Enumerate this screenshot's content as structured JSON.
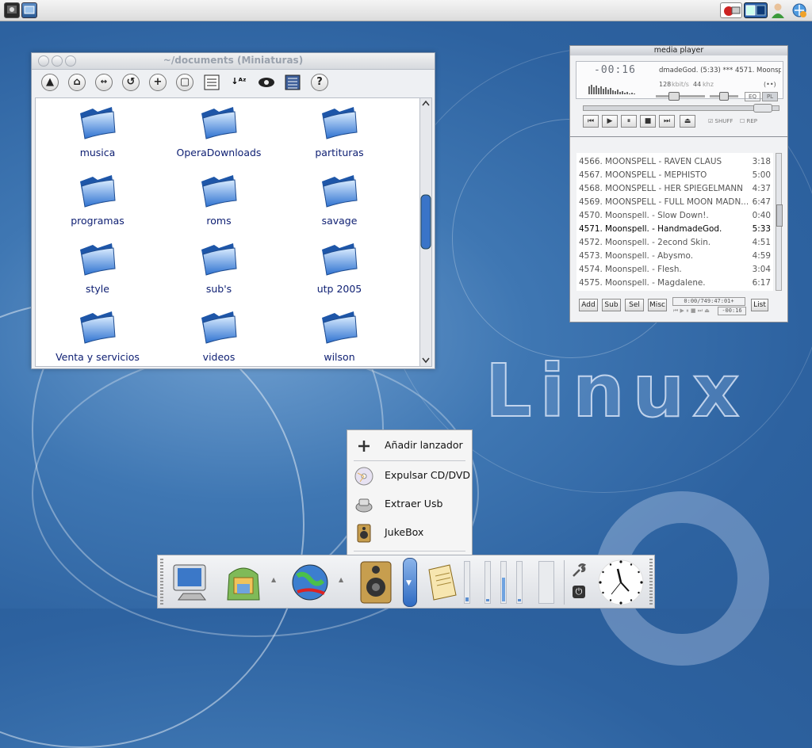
{
  "colors": {
    "folder_label": "#0d1e72",
    "desktop": "#3f77b3",
    "accent": "#2f72d0"
  },
  "desktop": {
    "watermark": "Linux"
  },
  "top_panel": {
    "left_icons": [
      "terminal-icon",
      "screen-icon"
    ],
    "right_icons": [
      "music-icon",
      "workspace-switcher-icon",
      "user-icon",
      "network-icon"
    ]
  },
  "file_window": {
    "title": "~/documents (Miniaturas)",
    "toolbar": [
      "up-icon",
      "home-icon",
      "navigate-icon",
      "reload-icon",
      "add-icon",
      "stop-icon",
      "list-view-icon",
      "sort-az-icon",
      "eye-icon",
      "details-view-icon",
      "help-icon"
    ],
    "folders": [
      "musica",
      "OperaDownloads",
      "partituras",
      "programas",
      "roms",
      "savage",
      "style",
      "sub's",
      "utp 2005",
      "Venta y servicios",
      "videos",
      "wilson"
    ]
  },
  "media_player": {
    "title": "media player",
    "time": "-00:16",
    "scroll_title": "dmadeGod. (5:33) *** 4571. Moonspell.",
    "bitrate": "128",
    "bitrate_unit": "kbit/s",
    "samplerate": "44",
    "samplerate_unit": "khz",
    "channels": "(••)",
    "eq": "EQ",
    "pl": "PL",
    "shuffle": "SHUFF",
    "repeat": "REP"
  },
  "playlist": {
    "rows": [
      {
        "title": "4566. MOONSPELL - RAVEN  CLAUS",
        "dur": "3:18"
      },
      {
        "title": "4567. MOONSPELL - MEPHISTO",
        "dur": "5:00"
      },
      {
        "title": "4568. MOONSPELL - HER SPIEGELMANN",
        "dur": "4:37"
      },
      {
        "title": "4569. MOONSPELL - FULL MOON MADN...",
        "dur": "6:47"
      },
      {
        "title": "4570. Moonspell. - Slow Down!.",
        "dur": "0:40"
      },
      {
        "title": "4571. Moonspell. - HandmadeGod.",
        "dur": "5:33"
      },
      {
        "title": "4572. Moonspell. - 2econd Skin.",
        "dur": "4:51"
      },
      {
        "title": "4573. Moonspell. - Abysmo.",
        "dur": "4:59"
      },
      {
        "title": "4574. Moonspell. - Flesh.",
        "dur": "3:04"
      },
      {
        "title": "4575. Moonspell. - Magdalene.",
        "dur": "6:17"
      }
    ],
    "current_index": 5,
    "buttons": {
      "add": "Add",
      "sub": "Sub",
      "sel": "Sel",
      "misc": "Misc",
      "list": "List"
    },
    "total_time": "0:00/749:47:01+",
    "time": "-00:16"
  },
  "context_menu": {
    "items": [
      {
        "label": "Añadir lanzador",
        "icon": "plus-icon"
      },
      {
        "label": "Expulsar CD/DVD",
        "icon": "cd-icon"
      },
      {
        "label": "Extraer Usb",
        "icon": "usb-icon"
      },
      {
        "label": "JukeBox",
        "icon": "speaker-icon"
      }
    ]
  },
  "bottom_panel": {
    "launchers": [
      "monitor-icon",
      "backpack-icon",
      "globe-icon",
      "speaker-icon",
      "volume-handle-icon",
      "notes-icon",
      "wrench-icon",
      "power-icon",
      "clock-icon"
    ]
  }
}
